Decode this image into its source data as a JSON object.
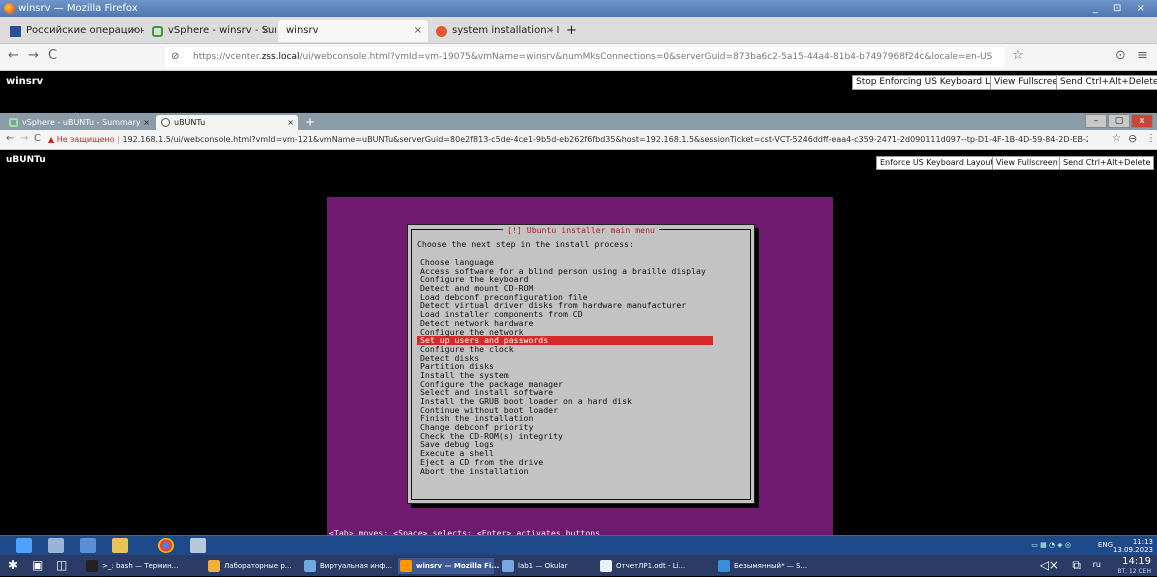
{
  "outer_window": {
    "title": "winsrv — Mozilla Firefox",
    "controls": "_ ⊡ ×"
  },
  "outer_tabs": [
    {
      "label": "Российские операционн",
      "close": "×"
    },
    {
      "label": "vSphere - winsrv - Summar",
      "close": "×"
    },
    {
      "label": "winsrv",
      "close": "×"
    },
    {
      "label": "system installation - Install",
      "close": "×"
    }
  ],
  "outer_new_tab": "+",
  "outer_nav": {
    "back": "←",
    "forward": "→",
    "reload": "C",
    "url_prefix": "https://vcenter.",
    "url_domain": "zss.local",
    "url_rest": "/ui/webconsole.html?vmId=vm-19075&vmName=winsrv&numMksConnections=0&serverGuid=873ba6c2-5a15-44a4-81b4-b7497968f24c&locale=en-US",
    "bookmark": "☆",
    "pocket": "⊙",
    "menu": "≡"
  },
  "vc_console": {
    "vm_name": "winsrv",
    "buttons": [
      "Stop Enforcing US Keyboard Layout",
      "View Fullscreen",
      "Send Ctrl+Alt+Delete"
    ]
  },
  "inner_tabs": [
    {
      "label": "vSphere - uBUNTu - Summary",
      "close": "×"
    },
    {
      "label": "uBUNTu",
      "close": "×"
    }
  ],
  "inner_new_tab": "+",
  "inner_window_controls": [
    "–",
    "▢",
    "x"
  ],
  "inner_nav": {
    "back": "←",
    "forward": "→",
    "reload": "C",
    "warning": "▲ Не защищено",
    "url": "192.168.1.5/ui/webconsole.html?vmId=vm-121&vmName=uBUNTu&serverGuid=80e2f813-c5de-4ce1-9b5d-eb262f6fbd35&host=192.168.1.5&sessionTicket=cst-VCT-5246ddff-eaa4-c359-2471-2d090111d097--tp-D1-4F-1B-4D-59-84-2D-EB-23-...",
    "star": "☆",
    "account": "⊖",
    "more": "⋮"
  },
  "inner_vc": {
    "vm_name": "uBUNTu",
    "buttons": [
      "Enforce US Keyboard Layout",
      "View Fullscreen",
      "Send Ctrl+Alt+Delete"
    ]
  },
  "installer": {
    "title": "[!] Ubuntu installer main menu",
    "prompt": "Choose the next step in the install process:",
    "items": [
      "Choose language",
      "Access software for a blind person using a braille display",
      "Configure the keyboard",
      "Detect and mount CD-ROM",
      "Load debconf preconfiguration file",
      "Detect virtual driver disks from hardware manufacturer",
      "Load installer components from CD",
      "Detect network hardware",
      "Configure the network",
      "Set up users and passwords",
      "Configure the clock",
      "Detect disks",
      "Partition disks",
      "Install the system",
      "Configure the package manager",
      "Select and install software",
      "Install the GRUB boot loader on a hard disk",
      "Continue without boot loader",
      "Finish the installation",
      "Change debconf priority",
      "Check the CD-ROM(s) integrity",
      "Save debug logs",
      "Execute a shell",
      "Eject a CD from the drive",
      "Abort the installation"
    ],
    "selected_index": 9,
    "hint": "<Tab> moves; <Space> selects; <Enter> activates buttons"
  },
  "inner_taskbar": {
    "lang": "ENG",
    "time": "11:13",
    "date": "13.09.2023"
  },
  "outer_taskbar": {
    "items": [
      ">_: bash — Термин...",
      "Лабораторные р...",
      "Виртуальная инф...",
      "winsrv — Mozilla Fi...",
      "lab1 — Okular",
      "ОтчетЛР1.odt - Li...",
      "Безымянный* — S..."
    ],
    "active_index": 3,
    "lang": "ru",
    "time": "14:19",
    "date": "ВТ, 12 СЕН"
  },
  "colors": {
    "installer_bg": "#6f1a6e",
    "dialog_bg": "#c3c3c3",
    "selection": "#d62a2a",
    "title_red": "#b21f1f"
  }
}
